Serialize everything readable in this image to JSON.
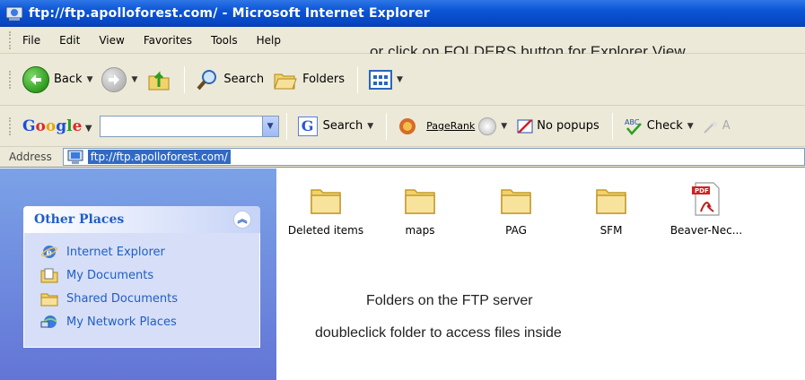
{
  "window": {
    "title": "ftp://ftp.apolloforest.com/ - Microsoft Internet Explorer"
  },
  "menubar": {
    "items": [
      "File",
      "Edit",
      "View",
      "Favorites",
      "Tools",
      "Help"
    ]
  },
  "annotations": {
    "top": "or click on FOLDERS button for Explorer View",
    "line1": "Folders on the FTP server",
    "line2": "doubleclick folder to access files inside"
  },
  "toolbar": {
    "back_label": "Back",
    "search_label": "Search",
    "folders_label": "Folders"
  },
  "google_bar": {
    "logo": "Google",
    "search_value": "",
    "search_label": "Search",
    "pagerank_label": "PageRank",
    "popups_label": "No popups",
    "check_label": "Check",
    "autofill_label": "A"
  },
  "address": {
    "label": "Address",
    "value": "ftp://ftp.apolloforest.com/"
  },
  "task_pane": {
    "other_places": {
      "title": "Other Places",
      "items": [
        {
          "label": "Internet Explorer",
          "icon": "internet-explorer-icon"
        },
        {
          "label": "My Documents",
          "icon": "my-documents-icon"
        },
        {
          "label": "Shared Documents",
          "icon": "shared-documents-icon"
        },
        {
          "label": "My Network Places",
          "icon": "network-places-icon"
        }
      ]
    }
  },
  "files": [
    {
      "name": "Deleted items",
      "type": "folder"
    },
    {
      "name": "maps",
      "type": "folder"
    },
    {
      "name": "PAG",
      "type": "folder"
    },
    {
      "name": "SFM",
      "type": "folder"
    },
    {
      "name": "Beaver-Nec...",
      "type": "pdf"
    }
  ],
  "colors": {
    "titlebar": "#0a55d6",
    "chrome": "#ece9d8",
    "taskpane": "#6f8ddd",
    "link": "#215dc6",
    "selection": "#316ac5"
  }
}
